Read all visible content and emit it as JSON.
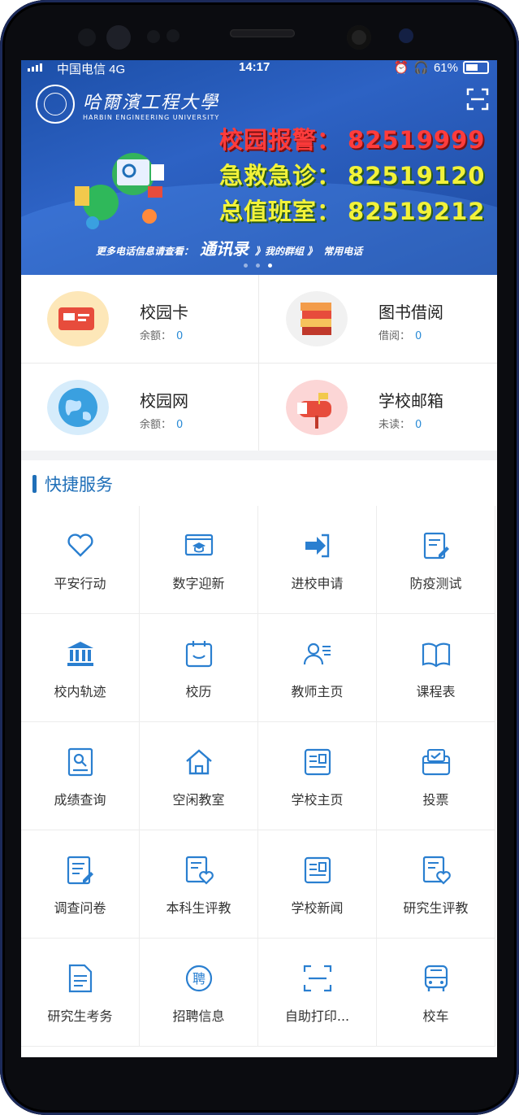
{
  "status_bar": {
    "carrier": "中国电信  4G",
    "time": "14:17",
    "battery": "61%"
  },
  "banner": {
    "university_cn": "哈爾濱工程大學",
    "university_en": "HARBIN ENGINEERING UNIVERSITY",
    "phones": [
      {
        "label": "校园报警：",
        "number": "82519999"
      },
      {
        "label": "急救急诊：",
        "number": "82519120"
      },
      {
        "label": "总值班室：",
        "number": "82519212"
      }
    ],
    "footer_prefix": "更多电话信息请查看：",
    "footer_link": "通讯录",
    "footer_step1": "》我的群组 》",
    "footer_step2": "常用电话",
    "page_count": 3,
    "active_page": 3
  },
  "cards": [
    {
      "title": "校园卡",
      "sub_label": "余额：",
      "sub_value": "0",
      "icon": "campus-card-icon"
    },
    {
      "title": "图书借阅",
      "sub_label": "借阅：",
      "sub_value": "0",
      "icon": "books-icon"
    },
    {
      "title": "校园网",
      "sub_label": "余额：",
      "sub_value": "0",
      "icon": "globe-icon"
    },
    {
      "title": "学校邮箱",
      "sub_label": "未读：",
      "sub_value": "0",
      "icon": "mailbox-icon"
    }
  ],
  "quick_services": {
    "title": "快捷服务",
    "items": [
      {
        "label": "平安行动",
        "icon": "heart-icon"
      },
      {
        "label": "数字迎新",
        "icon": "graduation-screen-icon"
      },
      {
        "label": "进校申请",
        "icon": "enter-icon"
      },
      {
        "label": "防疫测试",
        "icon": "edit-doc-icon"
      },
      {
        "label": "校内轨迹",
        "icon": "building-icon"
      },
      {
        "label": "校历",
        "icon": "calendar-icon"
      },
      {
        "label": "教师主页",
        "icon": "teacher-icon"
      },
      {
        "label": "课程表",
        "icon": "book-open-icon"
      },
      {
        "label": "成绩查询",
        "icon": "score-search-icon"
      },
      {
        "label": "空闲教室",
        "icon": "home-icon"
      },
      {
        "label": "学校主页",
        "icon": "newspaper-icon"
      },
      {
        "label": "投票",
        "icon": "vote-icon"
      },
      {
        "label": "调查问卷",
        "icon": "survey-icon"
      },
      {
        "label": "本科生评教",
        "icon": "eval-heart-icon"
      },
      {
        "label": "学校新闻",
        "icon": "news-icon"
      },
      {
        "label": "研究生评教",
        "icon": "eval-heart-icon"
      },
      {
        "label": "研究生考务",
        "icon": "doc-icon"
      },
      {
        "label": "招聘信息",
        "icon": "recruit-icon"
      },
      {
        "label": "自助打印...",
        "icon": "scan-icon"
      },
      {
        "label": "校车",
        "icon": "bus-icon"
      }
    ]
  },
  "colors": {
    "accent": "#1f6fb8",
    "icon_blue": "#2a7fd0",
    "value_blue": "#2a8bd6"
  }
}
